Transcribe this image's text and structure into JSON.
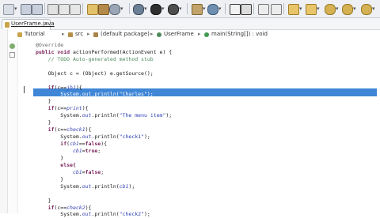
{
  "editor_tab": {
    "label": "UserFrame.java",
    "close": "×"
  },
  "breadcrumb": {
    "items": [
      "Tutorial",
      "src",
      "(default package)",
      "UserFrame",
      "main(String[]) : void"
    ],
    "separator": "▸"
  },
  "code_lines": [
    "@Override",
    "public void actionPerformed(ActionEvent e) {",
    "    // TODO Auto-generated method stub",
    "",
    "    Object c = (Object) e.getSource();",
    "",
    "    if(c==jb1){",
    "        System.out.println(\"Charles\");",
    "    }",
    "    if(c==print){",
    "        System.out.println(\"The menu item\");",
    "    }",
    "    if(c==check1){",
    "        System.out.println(\"check1\");",
    "        if(cb1==false){",
    "            cb1=true;",
    "        }",
    "        else{",
    "            cb1=false;",
    "        }",
    "        System.out.println(cb1);",
    "",
    "    }",
    "    if(c==check2){",
    "        System.out.println(\"check2\");"
  ],
  "colors": {
    "selection": "#3f86d6",
    "keyword": "#7a1f5a",
    "comment": "#4f8a5c",
    "string": "#2a3fb8",
    "field": "#3440b5"
  },
  "toolbar_icons": [
    "new-icon",
    "save-icon",
    "print-icon",
    "debug-icon",
    "run-icon",
    "search-icon",
    "back-icon",
    "forward-icon"
  ]
}
